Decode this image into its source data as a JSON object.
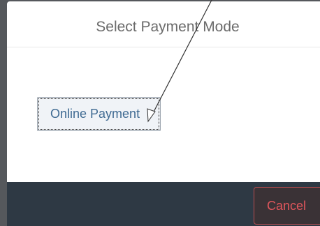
{
  "modal": {
    "title": "Select Payment Mode",
    "options": {
      "online_payment_label": "Online Payment"
    },
    "footer": {
      "cancel_label": "Cancel"
    }
  },
  "colors": {
    "footer_background": "#2e3944",
    "cancel_text": "#e0565c",
    "option_text": "#3f6a92",
    "annotation_arrow": "#333333"
  },
  "icons": {
    "annotation": "arrow-pointer-icon"
  }
}
